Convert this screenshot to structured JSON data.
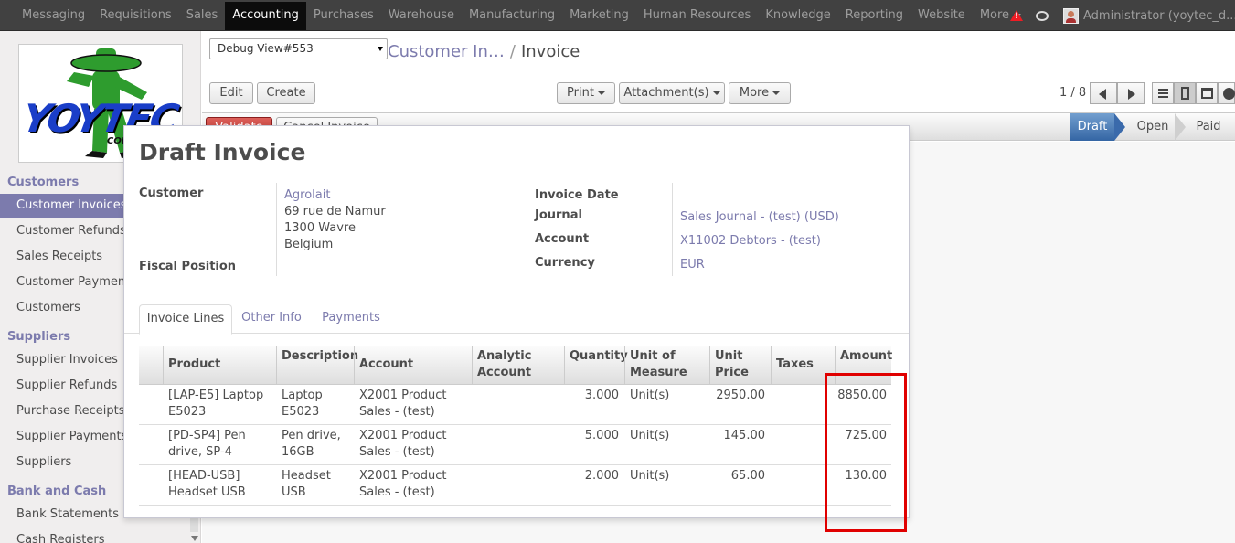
{
  "topbar": {
    "menu": [
      "Messaging",
      "Requisitions",
      "Sales",
      "Accounting",
      "Purchases",
      "Warehouse",
      "Manufacturing",
      "Marketing",
      "Human Resources",
      "Knowledge",
      "Reporting",
      "Website",
      "More"
    ],
    "active_index": 3,
    "alert_glyph": "!",
    "user_name": "Administrator (yoytec_d..."
  },
  "sidebar": {
    "logo_text": "YOYTEC",
    "logo_subtext": "COMPUTER",
    "sections": [
      {
        "title": "Customers",
        "items": [
          "Customer Invoices",
          "Customer Refunds",
          "Sales Receipts",
          "Customer Payments",
          "Customers"
        ]
      },
      {
        "title": "Suppliers",
        "items": [
          "Supplier Invoices",
          "Supplier Refunds",
          "Purchase Receipts",
          "Supplier Payments",
          "Suppliers"
        ]
      },
      {
        "title": "Bank and Cash",
        "items": [
          "Bank Statements",
          "Cash Registers"
        ]
      }
    ],
    "active_item": "Customer Invoices"
  },
  "control": {
    "debug_view": "Debug View#553",
    "breadcrumb_parent": "Customer In…",
    "breadcrumb_sep": "/",
    "breadcrumb_current": "Invoice",
    "edit_label": "Edit",
    "create_label": "Create",
    "print_label": "Print",
    "attachments_label": "Attachment(s)",
    "more_label": "More",
    "pager": "1 / 8"
  },
  "statusbar": {
    "validate_label": "Validate",
    "cancel_label": "Cancel Invoice",
    "stages": [
      "Draft",
      "Open",
      "Paid"
    ],
    "active_stage": "Draft"
  },
  "invoice": {
    "title": "Draft Invoice",
    "customer_label": "Customer",
    "customer_name": "Agrolait",
    "address_line1": "69 rue de Namur",
    "address_line2": "1300 Wavre",
    "address_line3": "Belgium",
    "fiscal_position_label": "Fiscal Position",
    "invoice_date_label": "Invoice Date",
    "invoice_date": "",
    "journal_label": "Journal",
    "journal": "Sales Journal - (test) (USD)",
    "account_label": "Account",
    "account": "X11002 Debtors - (test)",
    "currency_label": "Currency",
    "currency": "EUR"
  },
  "tabs": [
    "Invoice Lines",
    "Other Info",
    "Payments"
  ],
  "lines": {
    "headers": {
      "product": "Product",
      "description": "Description",
      "account": "Account",
      "analytic_1": "Analytic",
      "analytic_2": "Account",
      "quantity": "Quantity",
      "uom_1": "Unit of",
      "uom_2": "Measure",
      "price_1": "Unit",
      "price_2": "Price",
      "taxes": "Taxes",
      "amount": "Amount"
    },
    "rows": [
      {
        "product_1": "[LAP-E5] Laptop",
        "product_2": "E5023",
        "desc_1": "Laptop",
        "desc_2": "E5023",
        "account_1": "X2001 Product",
        "account_2": "Sales - (test)",
        "quantity": "3.000",
        "uom": "Unit(s)",
        "price": "2950.00",
        "amount": "8850.00"
      },
      {
        "product_1": "[PD-SP4] Pen",
        "product_2": "drive, SP-4",
        "desc_1": "Pen drive,",
        "desc_2": "16GB",
        "account_1": "X2001 Product",
        "account_2": "Sales - (test)",
        "quantity": "5.000",
        "uom": "Unit(s)",
        "price": "145.00",
        "amount": "725.00"
      },
      {
        "product_1": "[HEAD-USB]",
        "product_2": "Headset USB",
        "desc_1": "Headset",
        "desc_2": "USB",
        "account_1": "X2001 Product",
        "account_2": "Sales - (test)",
        "quantity": "2.000",
        "uom": "Unit(s)",
        "price": "65.00",
        "amount": "130.00"
      }
    ]
  },
  "colors": {
    "topbar": "#414141",
    "accent": "#7c7bad",
    "validate": "#c4302b",
    "highlight_box": "#e00000",
    "active_stage": "#3465a4"
  }
}
